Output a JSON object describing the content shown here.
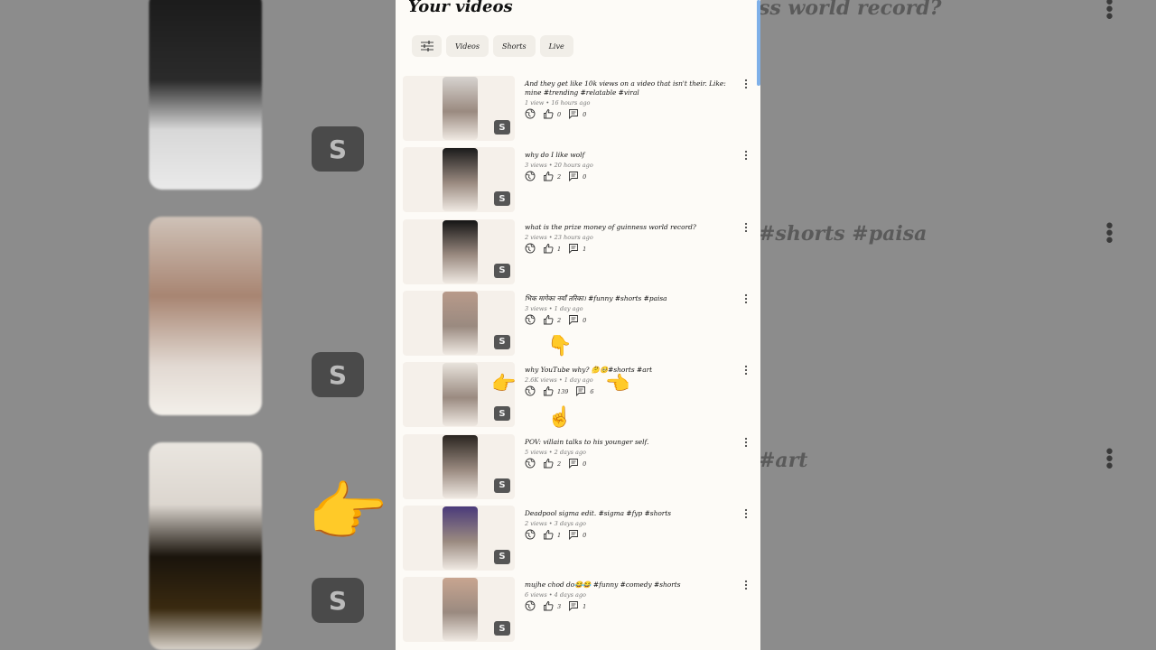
{
  "header": {
    "title": "Your videos"
  },
  "filters": {
    "icon": "tune-icon",
    "tabs": [
      "Videos",
      "Shorts",
      "Live"
    ]
  },
  "videos": [
    {
      "title": "And they get like 10k views on a video that isn't their. Like: mine #trending #relatable #viral",
      "meta": "1 view • 16 hours ago",
      "likes": "0",
      "comments": "0",
      "thumb": "#d7d3cf"
    },
    {
      "title": "why do I like wolf",
      "meta": "3 views • 20 hours ago",
      "likes": "2",
      "comments": "0",
      "thumb": "#1b1b1b"
    },
    {
      "title": "what is the prize money of  guinness world record?",
      "meta": "2 views • 23 hours ago",
      "likes": "1",
      "comments": "1",
      "thumb": "#141414"
    },
    {
      "title": "भिक मागेका नयाँ तरिका। #funny #shorts #paisa",
      "meta": "3 views • 1 day ago",
      "likes": "2",
      "comments": "0",
      "thumb": "#b89a8a"
    },
    {
      "title": "why YouTube why? 🤔🥺#shorts #art",
      "meta": "2.6K views • 1 day ago",
      "likes": "139",
      "comments": "6",
      "thumb": "#e8e3dc"
    },
    {
      "title": "POV: villain talks to his younger self.",
      "meta": "5 views • 2 days ago",
      "likes": "2",
      "comments": "0",
      "thumb": "#2a2520"
    },
    {
      "title": "Deadpool sigma edit.  #sigma #fyp #shorts",
      "meta": "2 views • 3 days ago",
      "likes": "1",
      "comments": "0",
      "thumb": "#4a3a7a"
    },
    {
      "title": "mujhe chod do😂😂 #funny #comedy #shorts",
      "meta": "6 views • 4 days ago",
      "likes": "3",
      "comments": "1",
      "thumb": "#c8a590"
    }
  ],
  "background": {
    "texts": [
      "ss world record?",
      "#shorts #paisa",
      "#art"
    ]
  },
  "icons": {
    "globe": "globe-icon",
    "like": "thumbs-up-icon",
    "comment": "comment-icon",
    "more": "more-vert-icon",
    "shorts": "shorts-logo-icon"
  },
  "emojis": {
    "down": "👇",
    "right": "👉",
    "left": "👈",
    "up": "☝️"
  }
}
